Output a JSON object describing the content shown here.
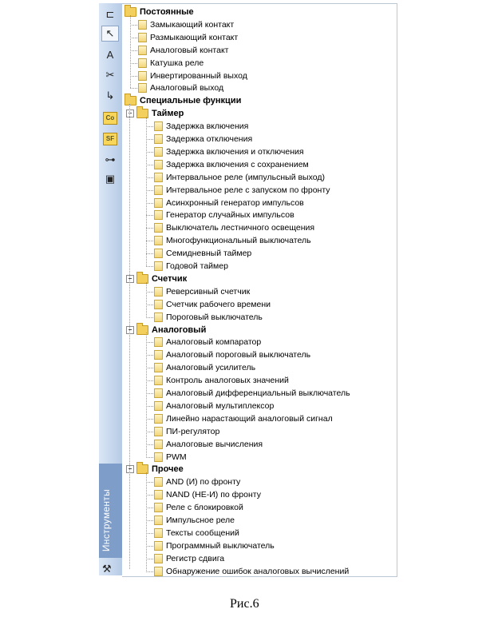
{
  "toolbar": {
    "tools": [
      {
        "name": "connector-tool-icon",
        "glyph": "⊏"
      },
      {
        "name": "select-arrow-icon",
        "glyph": "↖"
      },
      {
        "name": "text-tool-icon",
        "glyph": "A"
      },
      {
        "name": "cut-scissors-icon",
        "glyph": "✂"
      },
      {
        "name": "wire-tool-icon",
        "glyph": "↳"
      },
      {
        "name": "constants-co-icon",
        "glyph": "Co"
      },
      {
        "name": "special-functions-sf-icon",
        "glyph": "SF"
      },
      {
        "name": "network-tool-icon",
        "glyph": "⊶"
      },
      {
        "name": "network-blocks-icon",
        "glyph": "▣"
      }
    ],
    "panel_tab": "Инструменты"
  },
  "tree": {
    "constants": {
      "label": "Постоянные",
      "items": [
        "Замыкающий контакт",
        "Размыкающий контакт",
        "Аналоговый контакт",
        "Катушка реле",
        "Инвертированный выход",
        "Аналоговый выход"
      ]
    },
    "special": {
      "label": "Специальные функции",
      "timer": {
        "label": "Таймер",
        "items": [
          "Задержка включения",
          "Задержка отключения",
          "Задержка включения и отключения",
          "Задержка включения с сохранением",
          "Интервальное реле (импульсный выход)",
          "Интервальное реле с запуском по фронту",
          "Асинхронный генератор импульсов",
          "Генератор случайных импульсов",
          "Выключатель лестничного освещения",
          "Многофункциональный выключатель",
          "Семидневный таймер",
          "Годовой таймер"
        ]
      },
      "counter": {
        "label": "Счетчик",
        "items": [
          "Реверсивный счетчик",
          "Счетчик рабочего времени",
          "Пороговый выключатель"
        ]
      },
      "analog": {
        "label": "Аналоговый",
        "items": [
          "Аналоговый компаратор",
          "Аналоговый пороговый выключатель",
          "Аналоговый усилитель",
          "Контроль аналоговых значений",
          "Аналоговый дифференциальный выключатель",
          "Аналоговый мультиплексор",
          "Линейно нарастающий аналоговый сигнал",
          "ПИ-регулятор",
          "Аналоговые вычисления",
          "PWM"
        ]
      },
      "misc": {
        "label": "Прочее",
        "items": [
          "AND (И) по фронту",
          "NAND (НЕ-И) по фронту",
          "Реле с блокировкой",
          "Импульсное реле",
          "Тексты сообщений",
          "Программный выключатель",
          "Регистр сдвига",
          "Обнаружение ошибок аналоговых вычислений"
        ]
      }
    }
  },
  "caption": "Рис.6"
}
